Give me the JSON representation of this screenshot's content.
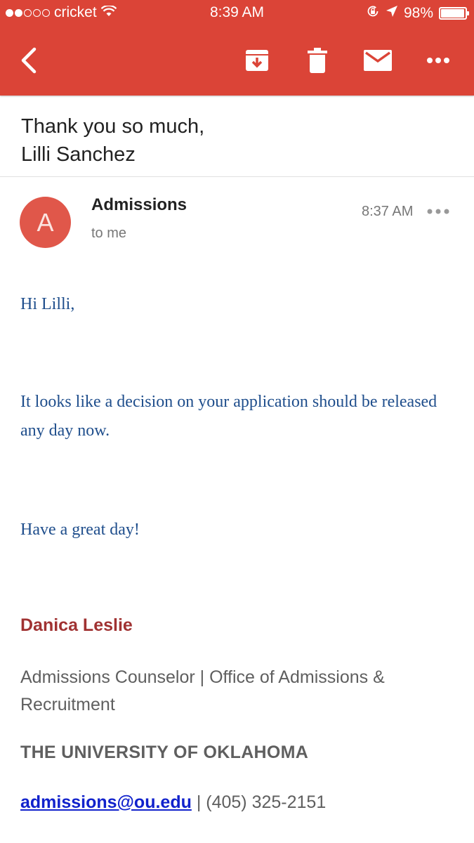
{
  "status_bar": {
    "carrier": "cricket",
    "time": "8:39 AM",
    "battery": "98%",
    "battery_level": 0.98
  },
  "toolbar": {
    "icons": [
      "back-icon",
      "archive-icon",
      "delete-icon",
      "mail-icon",
      "more-icon"
    ]
  },
  "email": {
    "subject_line1": "Thank you so much,",
    "subject_line2": "Lilli Sanchez",
    "avatar_letter": "A",
    "sender": "Admissions",
    "recipient": "to me",
    "time": "8:37 AM",
    "greeting": "Hi Lilli,",
    "paragraph": "It looks like a decision on your application should be released any day now.",
    "closing": "Have a great day!",
    "signature": {
      "name": "Danica Leslie",
      "title": "Admissions Counselor | Office of Admissions & Recruitment",
      "university": "THE UNIVERSITY OF OKLAHOMA",
      "email": "admissions@ou.edu",
      "separator": " | ",
      "phone": "(405) 325-2151"
    }
  },
  "colors": {
    "header": "#db4437",
    "avatar": "#e0574a",
    "body_text": "#1f4e8c",
    "signature_name": "#a03232",
    "link": "#1122cc"
  }
}
